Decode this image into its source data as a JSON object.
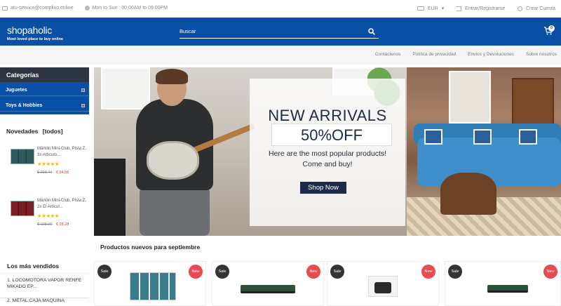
{
  "topbar": {
    "email": "atu-service@complixo.online",
    "hours": "Mon to Sun : 00:00AM to 09:00PM",
    "currency": "EUR",
    "login": "Entrar/Registrarse",
    "create_account": "Crear Cuenta"
  },
  "header": {
    "logo": "shopaholic",
    "tagline": "Most loved place to buy online",
    "search_placeholder": "Buscar",
    "cart_count": "0"
  },
  "nav": {
    "links": [
      "Contáctenos",
      "Política de privacidad",
      "Envíos y Devoluciones",
      "Sobre nosotros"
    ]
  },
  "sidebar": {
    "categories_title": "Categorías",
    "categories": [
      "Juguetes",
      "Toys & Hobbies"
    ],
    "novedades_title": "Novedades",
    "novedades_link": "[todos]",
    "products": [
      {
        "name": "Märklin Mini-Club, Pista Z, 3x Artículo...",
        "stars": "★★★★★",
        "old_price": "$ 298.44",
        "new_price": "€ 54.56"
      },
      {
        "name": "Märklin Mini-Club, Pista Z, 2x El Artícul...",
        "stars": "★★★★★",
        "old_price": "$ 108.00",
        "new_price": "€ 28.28"
      }
    ],
    "bestsellers_title": "Los más vendidos",
    "bestsellers": [
      "1. LOCOMOTORA VAPOR RENFE MIKADO EP...",
      "2. METAL CAJA MAQUINA"
    ]
  },
  "hero": {
    "title": "NEW ARRIVALS",
    "discount": "50%OFF",
    "subtitle_line1": "Here are the most popular products!",
    "subtitle_line2": "Come and buy!",
    "button": "Shop Now"
  },
  "products_section": {
    "title": "Productos nuevos para septiembre",
    "cards": [
      {
        "sale": "Sale",
        "new": "New"
      },
      {
        "sale": "Sale",
        "new": "New"
      },
      {
        "sale": "Sale",
        "new": "New"
      },
      {
        "sale": "Sale",
        "new": "New"
      }
    ]
  },
  "colors": {
    "brand_blue": "#0a4fa6",
    "dark_header": "#2c3540",
    "star": "#f6b800",
    "new_badge": "#e94b52"
  }
}
